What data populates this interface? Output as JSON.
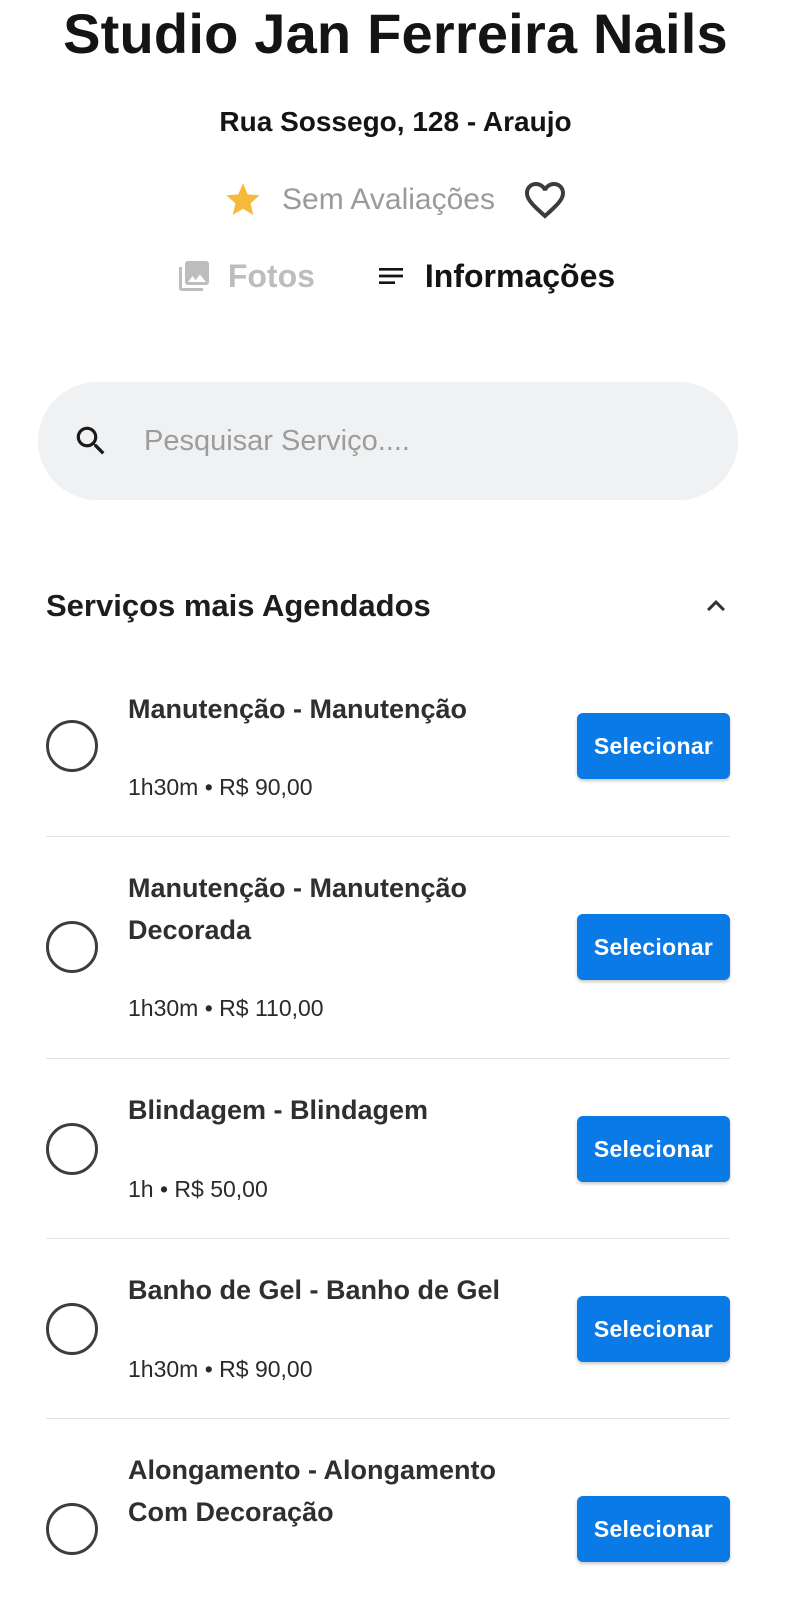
{
  "header": {
    "title": "Studio Jan Ferreira Nails",
    "address": "Rua Sossego, 128 - Araujo",
    "rating_text": "Sem Avaliações",
    "star_icon": "star-icon",
    "favorite_icon": "heart-outline-icon"
  },
  "tabs": [
    {
      "label": "Fotos",
      "icon": "photo-library-icon",
      "active": false
    },
    {
      "label": "Informações",
      "icon": "notes-icon",
      "active": true
    }
  ],
  "search": {
    "placeholder": "Pesquisar Serviço....",
    "value": ""
  },
  "section": {
    "title": "Serviços mais Agendados",
    "expanded": true
  },
  "services": [
    {
      "name": "Manutenção - Manutenção",
      "meta": "1h30m • R$ 90,00",
      "button_label": "Selecionar",
      "selected": false
    },
    {
      "name": "Manutenção - Manutenção Decorada",
      "meta": "1h30m • R$ 110,00",
      "button_label": "Selecionar",
      "selected": false
    },
    {
      "name": "Blindagem - Blindagem",
      "meta": "1h • R$ 50,00",
      "button_label": "Selecionar",
      "selected": false
    },
    {
      "name": "Banho de Gel - Banho de Gel",
      "meta": "1h30m • R$ 90,00",
      "button_label": "Selecionar",
      "selected": false
    },
    {
      "name": "Alongamento - Alongamento Com Decoração",
      "meta": "",
      "button_label": "Selecionar",
      "selected": false
    }
  ],
  "colors": {
    "accent": "#0a7ae6",
    "star": "#f6b93b",
    "search_bg": "#f0f1f3"
  }
}
